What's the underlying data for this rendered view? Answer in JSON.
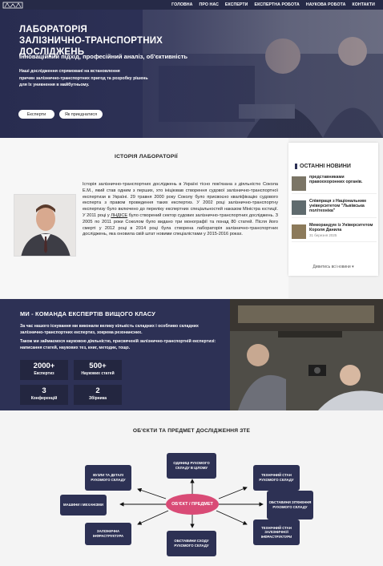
{
  "nav": {
    "items": [
      "ГОЛОВНА",
      "ПРО НАС",
      "ЕКСПЕРТИ",
      "ЕКСПЕРТНА РОБОТА",
      "НАУКОВА РОБОТА",
      "КОНТАКТИ"
    ]
  },
  "hero": {
    "title_line1": "ЛАБОРАТОРІЯ",
    "title_line2": "ЗАЛІЗНИЧНО-ТРАНСПОРТНИХ ДОСЛІДЖЕНЬ",
    "subtitle": "Інноваційний підхід, професійний аналіз, об'єктивність",
    "desc_line1": "Наші дослідження спрямовані на встановлення",
    "desc_line2": "причин залізнично-транспортних пригод та розробку рішень",
    "desc_line3": "для їх уникнення в майбутньому.",
    "btn_experts": "Експерти",
    "btn_join": "Як приєднатися"
  },
  "history": {
    "title": "ІСТОРІЯ ЛАБОРАТОРІЇ",
    "p1": "Історія залізнично-транспортних досліджень в Україні тісно пов'язана з діяльністю Сокола Е.М., який став одним з перших, хто ініціював створення судової залізнично-транспортної експертизи в Україні. 29 травня 2000 року Соколу було присвоєно кваліфікацію судового експерта з правом проведення таких експертиз. У 2002 році залізнично-транспортну експертизу було включено до переліку експертних спеціальностей наказом Міністра юстиції. У 2011 році у",
    "link": "ЛНДІСЕ",
    "p2": "було створений сектор судових залізнично-транспортних досліджень. З 2005 по 2011 роки Соколом було видано три монографії та понад 80 статей. Після його смерті у 2012 році в 2014 році була створена лабораторія залізнично-транспортних досліджень, яка оновила свій штат новими спеціалістами у 2015-2016 роках."
  },
  "news": {
    "heading": "ОСТАННІ НОВИНИ",
    "items": [
      {
        "text": "представниками правоохоронних органів.",
        "date": ""
      },
      {
        "text": "Співпраця з Національним університетом \"Львівська політехніка\"",
        "date": ""
      },
      {
        "text": "Меморандум із Університетом Короля Данила",
        "date": "31 березня 2025"
      }
    ],
    "all_link": "Дивитись всі новини ▾"
  },
  "team": {
    "title": "МИ - КОМАНДА ЕКСПЕРТІВ ВИЩОГО КЛАСУ",
    "p1": "За час нашого існування ми виконали велику кількість складних і особливо складних залізнично-транспортних експертиз, зокрема резонансних.",
    "p2": "Також ми займаємося науковою діяльністю, присвяченій залізнично-транспортній експертизі: написання статей, наукових тез, книг, методик, тощо.",
    "stats": [
      {
        "num": "2000+",
        "label": "Експертиз"
      },
      {
        "num": "500+",
        "label": "Наукових статей"
      },
      {
        "num": "3",
        "label": "Конференцій"
      },
      {
        "num": "2",
        "label": "Збірника"
      }
    ]
  },
  "objects": {
    "title": "ОБ'ЄКТИ ТА ПРЕДМЕТ ДОСЛІДЖЕННЯ ЗТЕ",
    "center": "ОБ'ЄКТ / ПРЕДМЕТ",
    "boxes": {
      "top": "ОДИНИЦІ РУХОМОГО СКЛАДУ В ЦІЛОМУ",
      "left_top": "ВУЗЛИ ТА ДЕТАЛІ РУХОМОГО СКЛАДУ",
      "left_mid": "МАШИНИ І МЕХАНІЗМИ",
      "left_bot": "ЗАЛІЗНИЧНА ІНФРАСТРУКТУРА",
      "bottom": "ОБСТАВИНИ СХОДУ РУХОМОГО СКЛАДУ",
      "right_top": "ТЕХНІЧНИЙ СТАН РУХОМОГО СКЛАДУ",
      "right_mid": "ОБСТАВИНИ ЗІТКНЕННЯ РУХОМОГО СКЛАДУ",
      "right_bot": "ТЕХНІЧНИЙ СТАН ЗАЛІЗНИЧНОЇ ІНФРАСТРУКТУРИ"
    }
  }
}
